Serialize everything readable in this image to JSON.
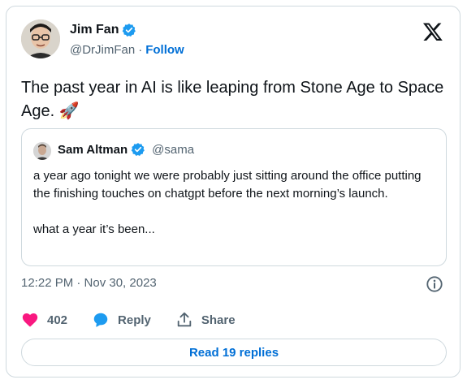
{
  "author": {
    "display_name": "Jim Fan",
    "handle": "@DrJimFan",
    "separator": "·",
    "follow_label": "Follow"
  },
  "tweet": {
    "text": "The past year in AI is like leaping from Stone Age to Space Age. 🚀"
  },
  "quote": {
    "display_name": "Sam Altman",
    "handle": "@sama",
    "line1": "a year ago tonight we were probably just sitting around the office putting the finishing touches on chatgpt before the next morning’s launch.",
    "line2": "what a year it’s been..."
  },
  "meta": {
    "timestamp": "12:22 PM · Nov 30, 2023"
  },
  "actions": {
    "likes": "402",
    "reply_label": "Reply",
    "share_label": "Share"
  },
  "replies_button": {
    "label": "Read 19 replies"
  },
  "colors": {
    "accent": "#006fd6",
    "verified": "#1d9bf0",
    "heart": "#f91880",
    "muted": "#536471"
  },
  "icons": [
    "verified-badge-icon",
    "x-logo-icon",
    "info-icon",
    "heart-icon",
    "reply-icon",
    "share-icon"
  ]
}
